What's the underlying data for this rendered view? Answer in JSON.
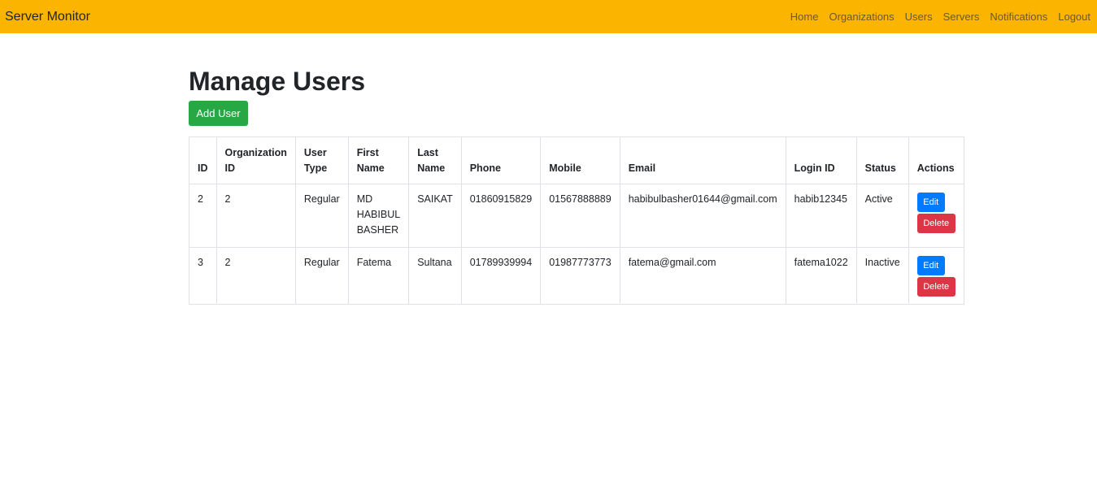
{
  "navbar": {
    "brand": "Server Monitor",
    "links": [
      "Home",
      "Organizations",
      "Users",
      "Servers",
      "Notifications",
      "Logout"
    ]
  },
  "page": {
    "title": "Manage Users",
    "add_button": "Add User"
  },
  "table": {
    "headers": [
      [
        "ID"
      ],
      [
        "Organization",
        "ID"
      ],
      [
        "User",
        "Type"
      ],
      [
        "First",
        "Name"
      ],
      [
        "Last",
        "Name"
      ],
      [
        "Phone"
      ],
      [
        "Mobile"
      ],
      [
        "Email"
      ],
      [
        "Login ID"
      ],
      [
        "Status"
      ],
      [
        "Actions"
      ]
    ],
    "rows": [
      {
        "id": "2",
        "org_id": "2",
        "user_type": "Regular",
        "first_name": [
          "MD",
          "HABIBUL",
          "BASHER"
        ],
        "last_name": "SAIKAT",
        "phone": "01860915829",
        "mobile": "01567888889",
        "email": "habibulbasher01644@gmail.com",
        "login_id": "habib12345",
        "status": "Active",
        "edit": "Edit",
        "delete": "Delete"
      },
      {
        "id": "3",
        "org_id": "2",
        "user_type": "Regular",
        "first_name": [
          "Fatema"
        ],
        "last_name": "Sultana",
        "phone": "01789939994",
        "mobile": "01987773773",
        "email": "fatema@gmail.com",
        "login_id": "fatema1022",
        "status": "Inactive",
        "edit": "Edit",
        "delete": "Delete"
      }
    ]
  },
  "colors": {
    "navbar": "#fbb400",
    "add_button": "#28a745",
    "edit_button": "#007bff",
    "delete_button": "#dc3545"
  }
}
